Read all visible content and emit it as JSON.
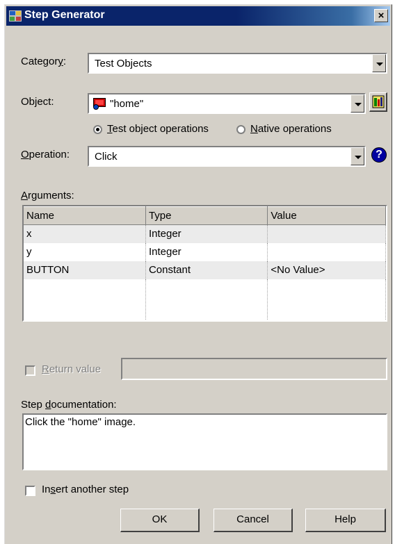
{
  "window": {
    "title": "Step Generator",
    "close_label": "×"
  },
  "category": {
    "label": "Category:",
    "value": "Test Objects"
  },
  "object": {
    "label": "Object:",
    "value": "\"home\""
  },
  "radio": {
    "test_label": "Test object operations",
    "native_label": "Native operations",
    "selected": "test"
  },
  "operation": {
    "label": "Operation:",
    "value": "Click",
    "help_glyph": "?"
  },
  "arguments": {
    "label": "Arguments:",
    "columns": [
      "Name",
      "Type",
      "Value"
    ],
    "rows": [
      [
        "x",
        "Integer",
        ""
      ],
      [
        "y",
        "Integer",
        ""
      ],
      [
        "BUTTON",
        "Constant",
        "<No Value>"
      ]
    ]
  },
  "return_value": {
    "label": "Return value",
    "value": ""
  },
  "documentation": {
    "label": "Step documentation:",
    "text": "Click the \"home\" image."
  },
  "insert_another": {
    "label": "Insert another step"
  },
  "buttons": {
    "ok": "OK",
    "cancel": "Cancel",
    "help": "Help"
  },
  "colors": {
    "title_bar": "#0a246a",
    "dialog_bg": "#d4d0c8",
    "help_icon": "#0000a0"
  }
}
